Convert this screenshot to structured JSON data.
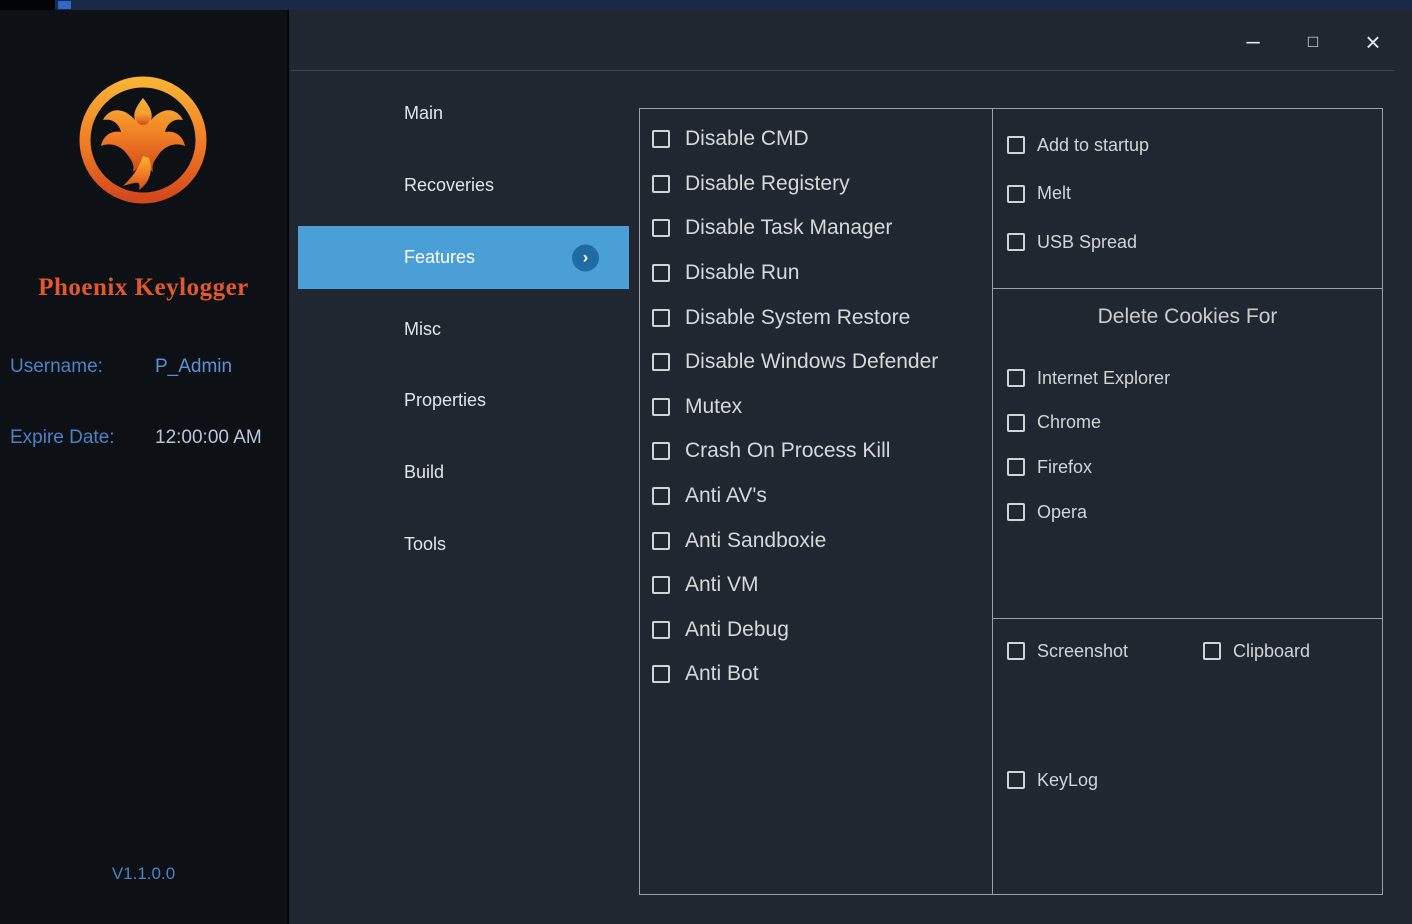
{
  "window": {
    "controls": {
      "minimize": "–",
      "maximize": "□",
      "close": "×"
    }
  },
  "sidebar": {
    "app_title": "Phoenix Keylogger",
    "username_label": "Username:",
    "username_value": "P_Admin",
    "expire_label": "Expire Date:",
    "expire_value": "12:00:00 AM",
    "version": "V1.1.0.0"
  },
  "nav": {
    "items": [
      {
        "label": "Main"
      },
      {
        "label": "Recoveries"
      },
      {
        "label": "Features",
        "selected": true
      },
      {
        "label": "Misc"
      },
      {
        "label": "Properties"
      },
      {
        "label": "Build"
      },
      {
        "label": "Tools"
      }
    ],
    "selected_chevron": "›"
  },
  "features": {
    "left": [
      "Disable CMD",
      "Disable Registery",
      "Disable Task Manager",
      "Disable Run",
      "Disable System Restore",
      "Disable Windows Defender",
      "Mutex",
      "Crash On Process Kill",
      "Anti AV's",
      "Anti Sandboxie",
      "Anti VM",
      "Anti Debug",
      "Anti Bot"
    ],
    "right_top": [
      "Add to startup",
      "Melt",
      "USB Spread"
    ],
    "cookies_heading": "Delete Cookies For",
    "cookies": [
      "Internet Explorer",
      "Chrome",
      "Firefox",
      "Opera"
    ],
    "capture_row": [
      "Screenshot",
      "Clipboard"
    ],
    "keylog": "KeyLog"
  },
  "colors": {
    "accent_blue": "#4aa0d6",
    "title_orange": "#e2572b",
    "label_blue": "#4c82c4"
  }
}
